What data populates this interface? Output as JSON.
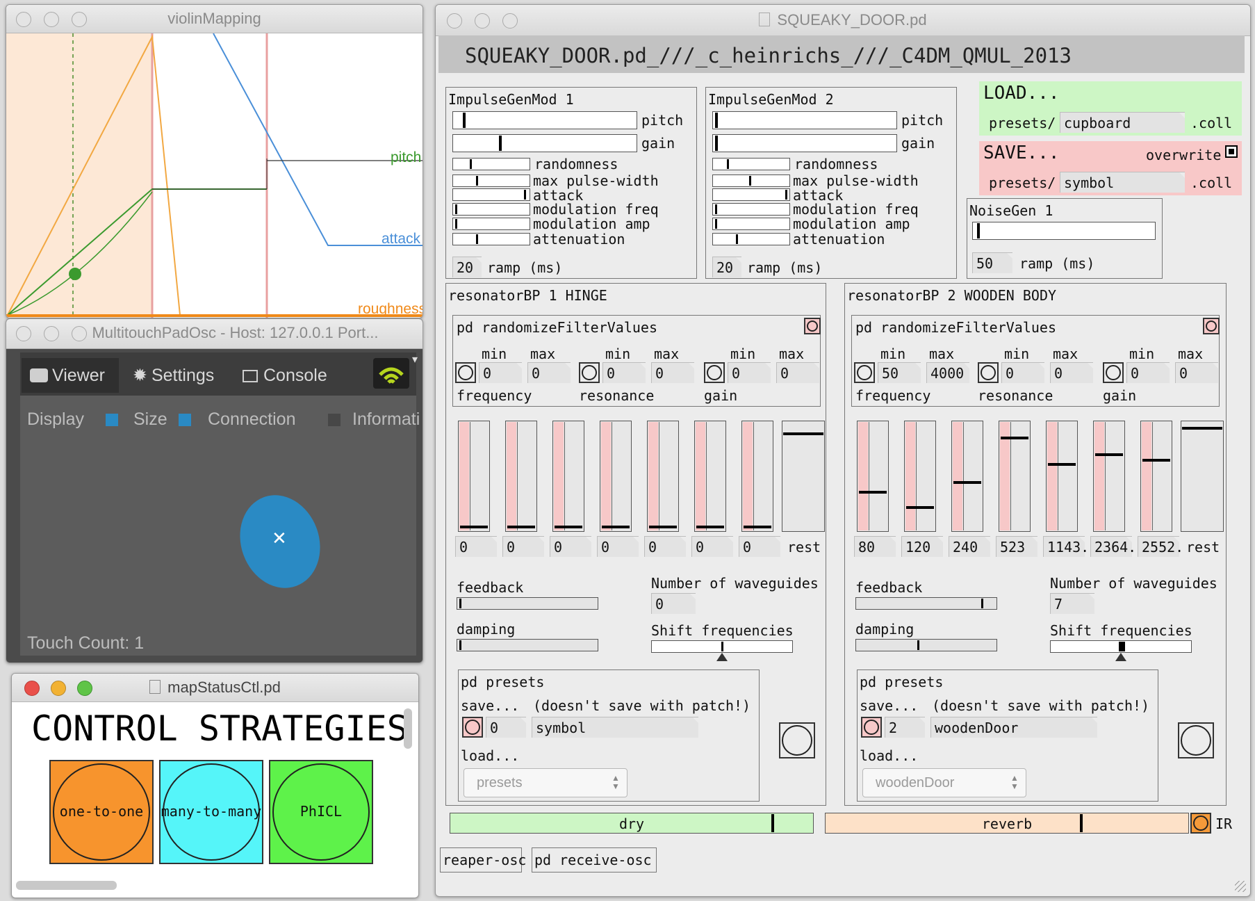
{
  "violin": {
    "title": "violinMapping",
    "labels": {
      "pitch": "pitch",
      "attack": "attack",
      "roughness": "roughness"
    }
  },
  "multitouch": {
    "title": "MultitouchPadOsc - Host: 127.0.0.1 Port...",
    "tabs": {
      "viewer": "Viewer",
      "settings": "Settings",
      "console": "Console"
    },
    "display": "Display",
    "size": "Size",
    "connection": "Connection",
    "information": "Informati",
    "touch_count": "Touch  Count: 1",
    "colors": {
      "accent": "#2a8ac4",
      "panel": "#5c5c5c"
    }
  },
  "mapstatus": {
    "title": "mapStatusCtl.pd",
    "heading": "CONTROL STRATEGIES",
    "buttons": [
      {
        "label": "one-to-one",
        "color": "#f7942d"
      },
      {
        "label": "many-to-many",
        "color": "#55f5f9"
      },
      {
        "label": "PhICL",
        "color": "#5ef24a"
      }
    ]
  },
  "squeaky": {
    "title": "SQUEAKY_DOOR.pd",
    "banner": "SQUEAKY_DOOR.pd_///_c_heinrichs_///_C4DM_QMUL_2013",
    "impulse": [
      {
        "title": "ImpulseGenMod 1",
        "ramp": "20"
      },
      {
        "title": "ImpulseGenMod 2",
        "ramp": "20"
      }
    ],
    "impulse_labels": {
      "pitch": "pitch",
      "gain": "gain",
      "randomness": "randomness",
      "max_pulse": "max pulse-width",
      "attack": "attack",
      "mod_freq": "modulation freq",
      "mod_amp": "modulation amp",
      "attenuation": "attenuation",
      "ramp": "ramp (ms)"
    },
    "load": {
      "title": "LOAD...",
      "prefix": "presets/",
      "value": "cupboard",
      "suffix": ".coll"
    },
    "save": {
      "title": "SAVE...",
      "overwrite": "overwrite",
      "prefix": "presets/",
      "value": "symbol",
      "suffix": ".coll"
    },
    "noise": {
      "title": "NoiseGen 1",
      "ramp": "50",
      "ramp_label": "ramp (ms)"
    },
    "resonators": [
      {
        "title": "resonatorBP 1 HINGE",
        "freq_min": "0",
        "freq_max": "0",
        "res_min": "0",
        "res_max": "0",
        "gain_min": "0",
        "gain_max": "0",
        "slider_values": [
          "0",
          "0",
          "0",
          "0",
          "0",
          "0",
          "0"
        ],
        "waveguides": "0",
        "preset_num": "0",
        "preset_name": "symbol",
        "preset_menu": "presets"
      },
      {
        "title": "resonatorBP 2 WOODEN BODY",
        "freq_min": "50",
        "freq_max": "4000",
        "res_min": "0",
        "res_max": "0",
        "gain_min": "0",
        "gain_max": "0",
        "slider_values": [
          "80",
          "120",
          "240",
          "523",
          "1143.",
          "2364.",
          "2552."
        ],
        "waveguides": "7",
        "preset_num": "2",
        "preset_name": "woodenDoor",
        "preset_menu": "woodenDoor"
      }
    ],
    "res_labels": {
      "randomize": "pd randomizeFilterValues",
      "min": "min",
      "max": "max",
      "frequency": "frequency",
      "resonance": "resonance",
      "gain": "gain",
      "rest": "rest",
      "feedback": "feedback",
      "damping": "damping",
      "num_waveguides": "Number of waveguides",
      "shift": "Shift frequencies",
      "presets": "pd presets",
      "save": "save...",
      "note": "(doesn't save with patch!)",
      "load": "load..."
    },
    "dry": "dry",
    "reverb": "reverb",
    "ir": "IR",
    "bottom": {
      "reaper": "reaper-osc",
      "receive": "pd receive-osc"
    }
  }
}
